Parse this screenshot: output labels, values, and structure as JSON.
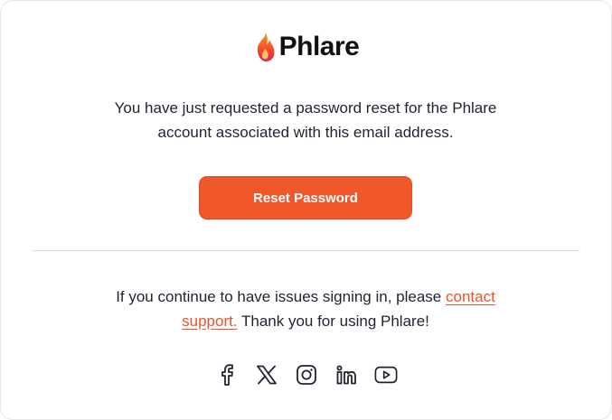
{
  "brand": {
    "name": "Phlare",
    "accent_color": "#f0572a",
    "logo_icon": "flame-icon"
  },
  "intro": {
    "line1": "You have just requested a password reset for the Phlare",
    "line2": "account associated with this email address."
  },
  "reset_button": {
    "label": "Reset Password"
  },
  "footer": {
    "text_before": "If you continue to have issues signing in, please ",
    "link_label_1": "contact",
    "link_label_2": "support.",
    "text_after": " Thank you for using Phlare!"
  },
  "social": [
    {
      "name": "facebook-icon"
    },
    {
      "name": "x-icon"
    },
    {
      "name": "instagram-icon"
    },
    {
      "name": "linkedin-icon"
    },
    {
      "name": "youtube-icon"
    }
  ]
}
